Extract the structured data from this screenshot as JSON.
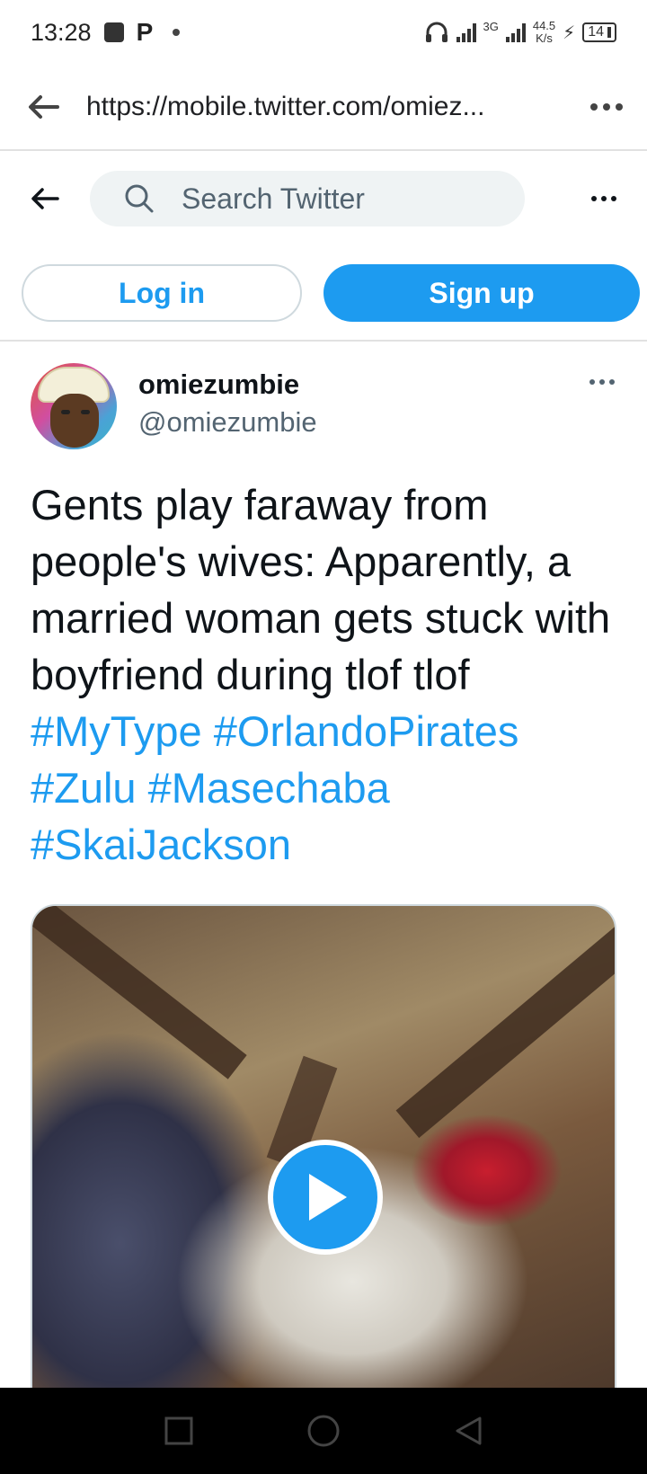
{
  "status_bar": {
    "time": "13:28",
    "network": "3G",
    "speed_value": "44.5",
    "speed_unit": "K/s",
    "battery": "14"
  },
  "browser": {
    "url": "https://mobile.twitter.com/omiez..."
  },
  "twitter_header": {
    "search_placeholder": "Search Twitter"
  },
  "auth": {
    "login_label": "Log in",
    "signup_label": "Sign up"
  },
  "tweet": {
    "display_name": "omiezumbie",
    "handle": "@omiezumbie",
    "text": "Gents play faraway from people's wives: Apparently, a married woman gets stuck with boyfriend during tlof tlof",
    "hashtags": [
      "#MyType",
      "#OrlandoPirates",
      "#Zulu",
      "#Masechaba",
      "#SkaiJackson"
    ]
  },
  "colors": {
    "accent": "#1d9bf0",
    "text_primary": "#0f1419",
    "text_secondary": "#536471"
  },
  "icons": {
    "browser_back": "arrow-left-icon",
    "browser_more": "more-horizontal-icon",
    "twitter_back": "arrow-left-icon",
    "search": "search-icon",
    "play": "play-icon"
  }
}
